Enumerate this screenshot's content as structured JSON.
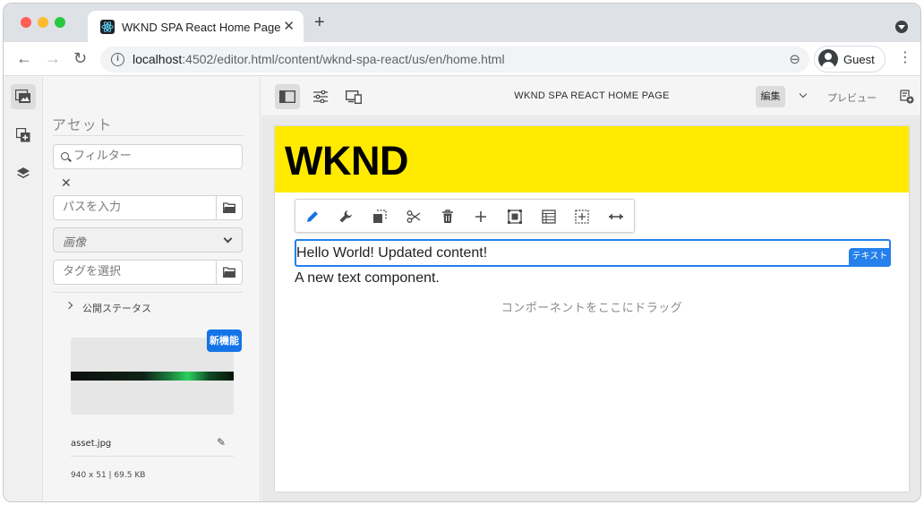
{
  "browser": {
    "tab_title": "WKND SPA React Home Page",
    "tab_close": "✕",
    "new_tab": "+",
    "url_host": "localhost",
    "url_path": ":4502/editor.html/content/wknd-spa-react/us/en/home.html",
    "profile_name": "Guest",
    "nav_back": "←",
    "nav_forward": "→",
    "nav_reload": "↻",
    "menu": "⋮",
    "zoom_glyph": "⊖"
  },
  "assets_panel": {
    "title": "アセット",
    "filter_placeholder": "フィルター",
    "clear": "✕",
    "path_placeholder": "パスを入力",
    "type_select": "画像",
    "tags_placeholder": "タグを選択",
    "status_label": "公開ステータス",
    "new_badge": "新機能",
    "asset_name": "asset.jpg",
    "asset_meta": "940 x 51 | 69.5 KB",
    "edit_glyph": "✎"
  },
  "editor": {
    "page_title": "WKND SPA REACT HOME PAGE",
    "mode": "編集",
    "preview": "プレビュー"
  },
  "page": {
    "logo": "WKND",
    "selected_text": "Hello World! Updated content!",
    "component_label": "テキスト",
    "text2": "A new text component.",
    "dropzone": "コンポーネントをここにドラッグ"
  },
  "colors": {
    "header_yellow": "#ffea00",
    "accent_blue": "#2680eb",
    "badge_blue": "#1473e6"
  }
}
